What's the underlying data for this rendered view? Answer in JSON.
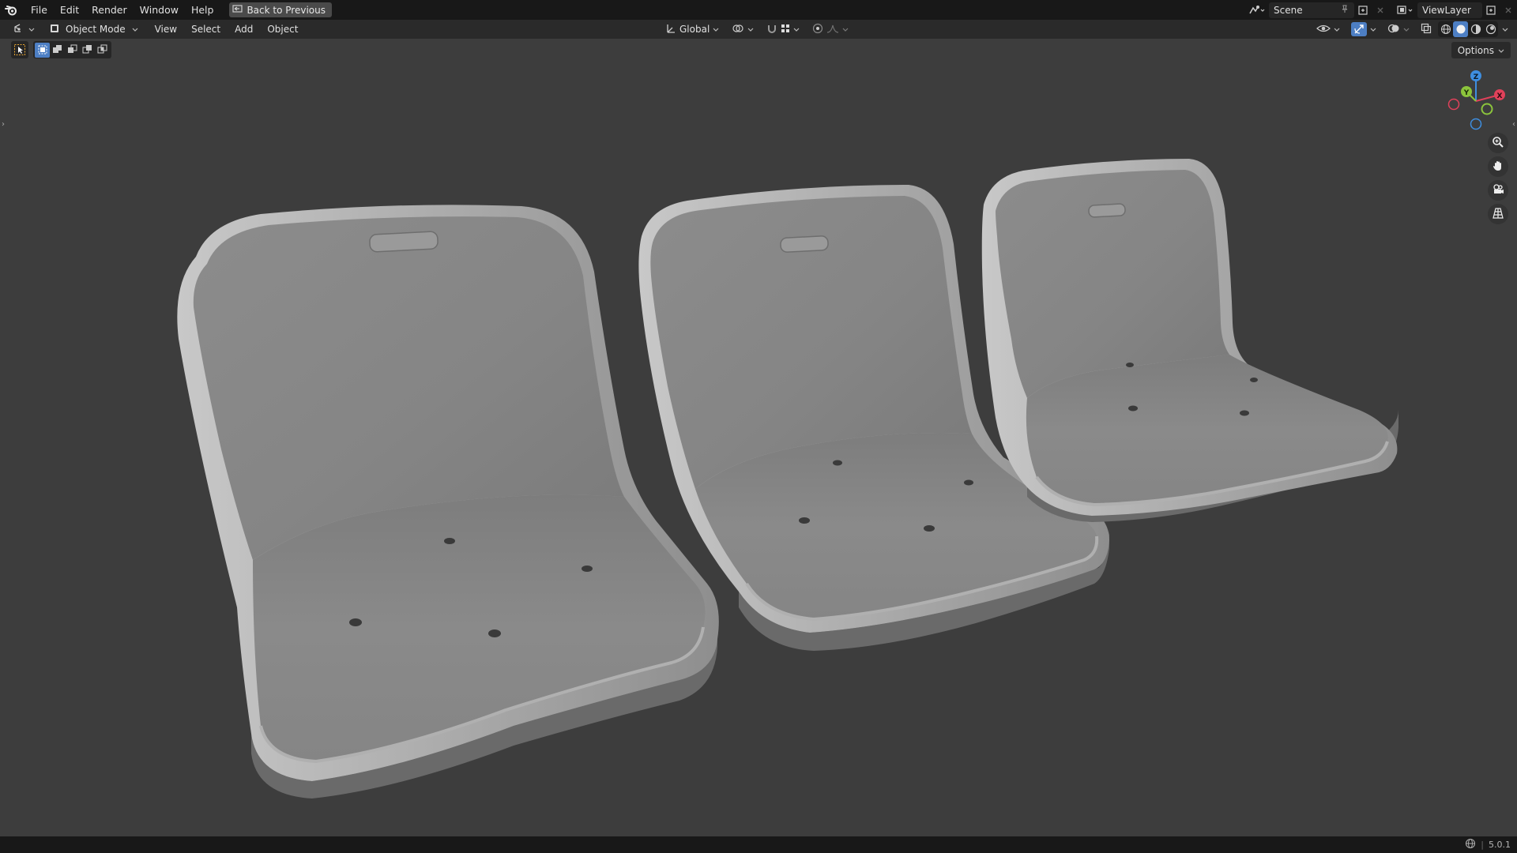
{
  "topbar": {
    "menus": [
      "File",
      "Edit",
      "Render",
      "Window",
      "Help"
    ],
    "back_button": "Back to Previous",
    "scene_name": "Scene",
    "view_layer": "ViewLayer"
  },
  "header": {
    "mode": "Object Mode",
    "menus": [
      "View",
      "Select",
      "Add",
      "Object"
    ],
    "orientation": "Global"
  },
  "options_label": "Options",
  "gizmo": {
    "axes": [
      "X",
      "Y",
      "Z"
    ],
    "colors": {
      "x": "#e0415a",
      "y": "#8cc43c",
      "z": "#3e8ee0"
    }
  },
  "viewport": {
    "background": "#3d3d3d",
    "objects": [
      "seat-large",
      "seat-medium",
      "seat-small"
    ]
  },
  "statusbar": {
    "version": "5.0.1"
  },
  "accent_color": "#4d7fc4"
}
